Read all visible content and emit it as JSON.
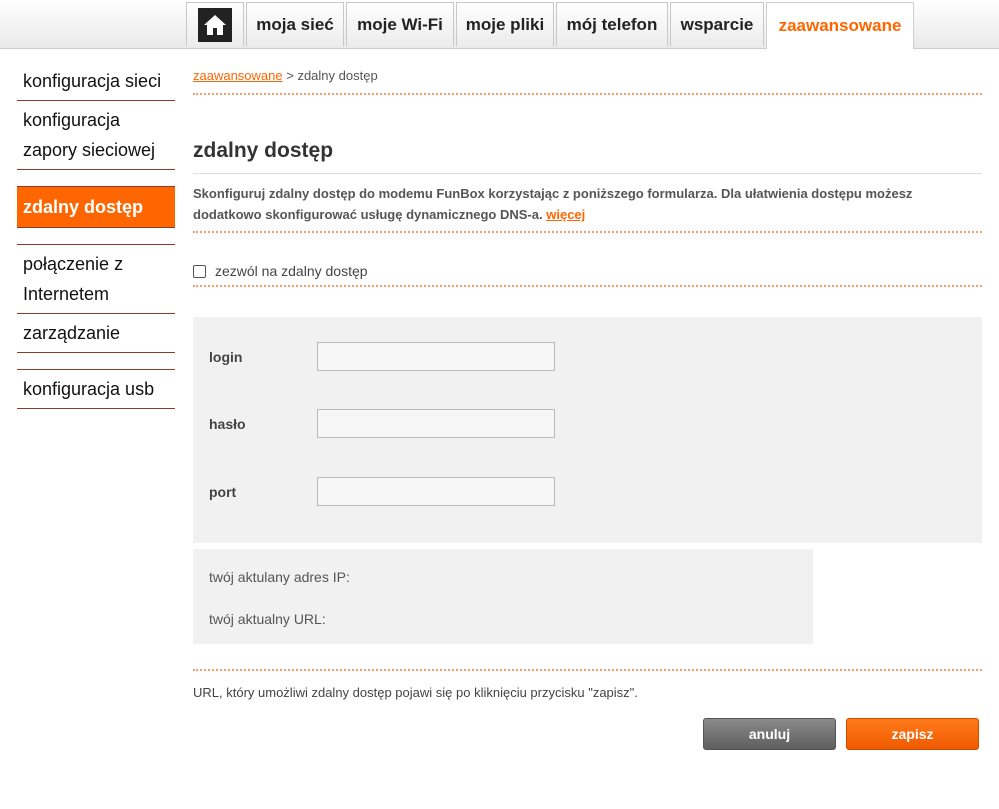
{
  "nav": {
    "home_icon": "home-icon",
    "tabs": [
      {
        "label": "moja sieć"
      },
      {
        "label": "moje Wi-Fi"
      },
      {
        "label": "moje pliki"
      },
      {
        "label": "mój telefon"
      },
      {
        "label": "wsparcie"
      },
      {
        "label": "zaawansowane",
        "active": true
      }
    ]
  },
  "sidebar": {
    "items": [
      {
        "label": "konfiguracja sieci"
      },
      {
        "label": "konfiguracja zapory sieciowej"
      },
      {
        "label": "zdalny dostęp",
        "active": true
      },
      {
        "label": "połączenie z Internetem"
      },
      {
        "label": "zarządzanie"
      },
      {
        "label": "konfiguracja usb"
      }
    ]
  },
  "breadcrumb": {
    "link": "zaawansowane",
    "separator": " > ",
    "current": "zdalny dostęp"
  },
  "page": {
    "title": "zdalny dostęp",
    "description": "Skonfiguruj zdalny dostęp do modemu FunBox korzystając z poniższego formularza. Dla ułatwienia dostępu możesz dodatkowo skonfigurować usługę dynamicznego DNS-a.",
    "more_link": "więcej",
    "checkbox_label": "zezwól na zdalny dostęp",
    "checkbox_checked": false
  },
  "form": {
    "login_label": "login",
    "login_value": "",
    "password_label": "hasło",
    "password_value": "",
    "port_label": "port",
    "port_value": ""
  },
  "info": {
    "ip_label": "twój aktulany adres IP:",
    "url_label": "twój aktualny URL:"
  },
  "note": "URL, który umożliwi zdalny dostęp pojawi się po kliknięciu przycisku \"zapisz\".",
  "buttons": {
    "cancel": "anuluj",
    "save": "zapisz"
  },
  "colors": {
    "accent": "#ff6600",
    "panel": "#f1f1f1",
    "cancel_button": "#6e6e6e"
  }
}
